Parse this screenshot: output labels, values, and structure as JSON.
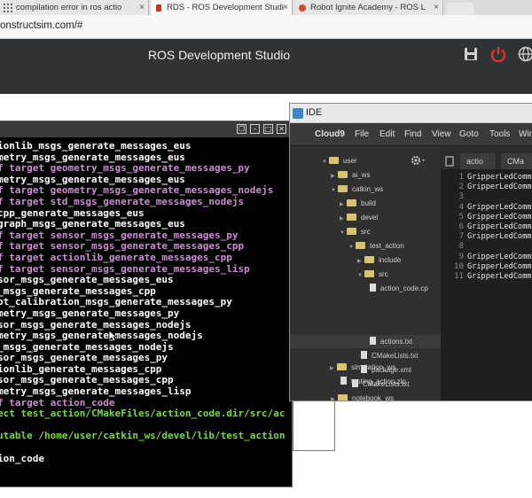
{
  "browser": {
    "tabs": [
      {
        "label": "compilation error in ros actio",
        "close": "×"
      },
      {
        "label": "RDS - ROS Development Studi",
        "close": "×"
      },
      {
        "label": "Robot Ignite Academy - ROS L",
        "close": "×"
      }
    ],
    "address": "onstructsim.com/#"
  },
  "app": {
    "title": "ROS Development Studio"
  },
  "terminal": {
    "lines": [
      {
        "text": "ionlib_msgs_generate_messages_eus",
        "color": "#ffffff"
      },
      {
        "text": "metry_msgs_generate_messages_eus",
        "color": "#ffffff"
      },
      {
        "text": "f target geometry_msgs_generate_messages_py",
        "color": "#c98fd0"
      },
      {
        "text": "metry_msgs_generate_messages_eus",
        "color": "#ffffff"
      },
      {
        "text": "f target geometry_msgs_generate_messages_nodejs",
        "color": "#c98fd0"
      },
      {
        "text": "f target std_msgs_generate_messages_nodejs",
        "color": "#c98fd0"
      },
      {
        "text": "cpp_generate_messages_eus",
        "color": "#ffffff"
      },
      {
        "text": "graph_msgs_generate_messages_eus",
        "color": "#ffffff"
      },
      {
        "text": "f target sensor_msgs_generate_messages_py",
        "color": "#c98fd0"
      },
      {
        "text": "f target sensor_msgs_generate_messages_cpp",
        "color": "#c98fd0"
      },
      {
        "text": "f target actionlib_generate_messages_cpp",
        "color": "#c98fd0"
      },
      {
        "text": "f target sensor_msgs_generate_messages_lisp",
        "color": "#c98fd0"
      },
      {
        "text": "sor_msgs_generate_messages_eus",
        "color": "#ffffff"
      },
      {
        "text": "_msgs_generate_messages_cpp",
        "color": "#ffffff"
      },
      {
        "text": "ot_calibration_msgs_generate_messages_py",
        "color": "#ffffff"
      },
      {
        "text": "metry_msgs_generate_messages_py",
        "color": "#ffffff"
      },
      {
        "text": "sor_msgs_generate_messages_nodejs",
        "color": "#ffffff"
      },
      {
        "text": "metry_msgs_generate_messages_nodejs",
        "color": "#ffffff"
      },
      {
        "text": "_msgs_generate_messages_nodejs",
        "color": "#ffffff"
      },
      {
        "text": "sor_msgs_generate_messages_py",
        "color": "#ffffff"
      },
      {
        "text": "ionlib_generate_messages_cpp",
        "color": "#ffffff"
      },
      {
        "text": "sor_msgs_generate_messages_cpp",
        "color": "#ffffff"
      },
      {
        "text": "metry_msgs_generate_messages_lisp",
        "color": "#ffffff"
      },
      {
        "text": "f target action_code",
        "color": "#c98fd0"
      },
      {
        "text": "ect test_action/CMakeFiles/action_code.dir/src/ac",
        "color": "#78d94a"
      },
      {
        "text": "",
        "color": "#ffffff"
      },
      {
        "text": "utable /home/user/catkin_ws/devel/lib/test_action",
        "color": "#78d94a"
      },
      {
        "text": "",
        "color": "#ffffff"
      },
      {
        "text": "ion_code",
        "color": "#ffffff"
      }
    ]
  },
  "ide": {
    "window_title": "IDE",
    "menu": [
      "Cloud9",
      "File",
      "Edit",
      "Find",
      "View",
      "Goto",
      "Tools",
      "Win"
    ],
    "tree": [
      {
        "label": "user",
        "type": "folder",
        "open": true
      },
      {
        "label": "ai_ws",
        "type": "folder",
        "open": false
      },
      {
        "label": "catkin_ws",
        "type": "folder",
        "open": true
      },
      {
        "label": "build",
        "type": "folder",
        "open": false
      },
      {
        "label": "devel",
        "type": "folder",
        "open": false
      },
      {
        "label": "src",
        "type": "folder",
        "open": true
      },
      {
        "label": "test_action",
        "type": "folder",
        "open": true
      },
      {
        "label": "include",
        "type": "folder",
        "open": false
      },
      {
        "label": "src",
        "type": "folder",
        "open": true
      },
      {
        "label": "action_code.cp",
        "type": "file"
      },
      {
        "label": "actions.txt",
        "type": "file"
      },
      {
        "label": "CMakeLists.txt",
        "type": "file"
      },
      {
        "label": "package.xml",
        "type": "file"
      },
      {
        "label": "CMakeLists.txt",
        "type": "file"
      },
      {
        "label": "notebook_ws",
        "type": "folder",
        "open": false
      },
      {
        "label": "simulation_ws",
        "type": "folder",
        "open": false
      },
      {
        "label": "testing_action.zip",
        "type": "file"
      }
    ],
    "editor_tabs": [
      "actio",
      "CMa"
    ],
    "line_numbers": [
      "1",
      "2",
      "3",
      "4",
      "5",
      "6",
      "7",
      "8",
      "9",
      "10",
      "11"
    ],
    "code_lines": [
      "GripperLedComma",
      "GripperLedComma",
      "",
      "GripperLedComma",
      "GripperLedComma",
      "GripperLedComma",
      "GripperLedComma",
      "",
      "GripperLedComma",
      "GripperLedComma",
      "GripperLedComma"
    ]
  },
  "colors": {
    "accent_power": "#e0322c",
    "terminal_white": "#ffffff",
    "terminal_purple": "#c98fd0",
    "terminal_green": "#78d94a"
  }
}
